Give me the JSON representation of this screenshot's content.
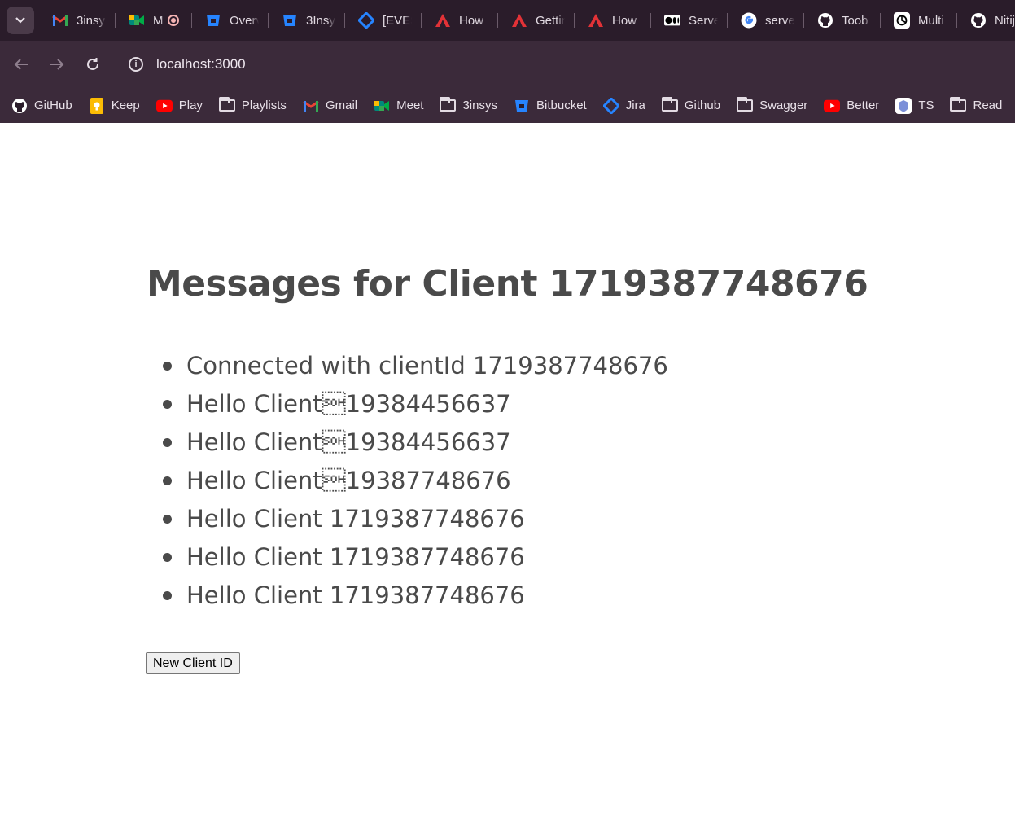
{
  "browser": {
    "tabs": [
      {
        "title": "3insy",
        "icon": "gmail-icon",
        "color": "#ea4335"
      },
      {
        "title": "M",
        "icon": "google-meet-icon",
        "color": "#00897b",
        "recording": true
      },
      {
        "title": "Overv",
        "icon": "bitbucket-icon",
        "color": "#2684ff"
      },
      {
        "title": "3Insy",
        "icon": "bitbucket-icon",
        "color": "#2684ff"
      },
      {
        "title": "[EVES",
        "icon": "jira-icon",
        "color": "#2684ff"
      },
      {
        "title": "How",
        "icon": "angular-icon",
        "color": "#e23237"
      },
      {
        "title": "Gettin",
        "icon": "angular-icon",
        "color": "#e23237"
      },
      {
        "title": "How",
        "icon": "angular-icon",
        "color": "#e23237"
      },
      {
        "title": "Serve",
        "icon": "medium-icon",
        "color": "#000000"
      },
      {
        "title": "serve",
        "icon": "google-icon",
        "color": "#4285f4"
      },
      {
        "title": "Toob",
        "icon": "github-icon",
        "color": "#ffffff"
      },
      {
        "title": "Multi",
        "icon": "chatgpt-icon",
        "color": "#ffffff"
      },
      {
        "title": "Nitij",
        "icon": "github-icon",
        "color": "#ffffff"
      }
    ],
    "address": "localhost:3000",
    "bookmarks": [
      {
        "label": "GitHub",
        "icon": "github-icon"
      },
      {
        "label": "Keep",
        "icon": "google-keep-icon"
      },
      {
        "label": "Play",
        "icon": "youtube-icon"
      },
      {
        "label": "Playlists",
        "icon": "folder-icon"
      },
      {
        "label": "Gmail",
        "icon": "gmail-icon"
      },
      {
        "label": "Meet",
        "icon": "google-meet-icon"
      },
      {
        "label": "3insys",
        "icon": "folder-icon"
      },
      {
        "label": "Bitbucket",
        "icon": "bitbucket-icon"
      },
      {
        "label": "Jira",
        "icon": "jira-icon"
      },
      {
        "label": "Github",
        "icon": "folder-icon"
      },
      {
        "label": "Swagger",
        "icon": "folder-icon"
      },
      {
        "label": "Better",
        "icon": "youtube-icon"
      },
      {
        "label": "TS",
        "icon": "ts-icon"
      },
      {
        "label": "Read",
        "icon": "folder-icon"
      }
    ]
  },
  "page": {
    "heading": "Messages for Client 1719387748676",
    "messages": [
      "Connected with clientId 1719387748676",
      "Hello Client\u000119384456637",
      "Hello Client\u000119384456637",
      "Hello Client\u000119387748676",
      "Hello Client 1719387748676",
      "Hello Client 1719387748676",
      "Hello Client 1719387748676"
    ],
    "new_client_button": "New Client ID"
  }
}
